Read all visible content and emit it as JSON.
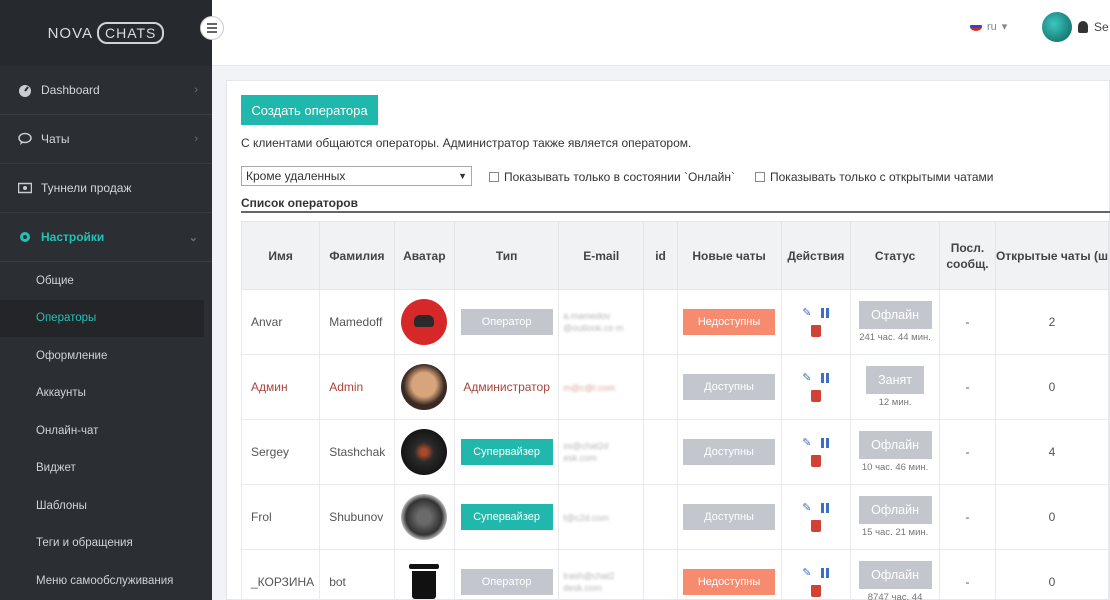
{
  "app": {
    "logo_left": "NOVA",
    "logo_right": "CHATS"
  },
  "sidebar": {
    "items": [
      {
        "label": "Dashboard",
        "icon": "dashboard-icon"
      },
      {
        "label": "Чаты",
        "icon": "chat-bubble-icon"
      },
      {
        "label": "Туннели продаж",
        "icon": "money-icon"
      },
      {
        "label": "Настройки",
        "icon": "gear-icon"
      }
    ],
    "submenu": [
      "Общие",
      "Операторы",
      "Оформление",
      "Аккаунты",
      "Онлайн-чат",
      "Виджет",
      "Шаблоны",
      "Теги и обращения",
      "Меню самообслуживания"
    ]
  },
  "topbar": {
    "lang": "ru",
    "user_name": "Se"
  },
  "main": {
    "create_button": "Создать оператора",
    "info": "С клиентами общаются операторы. Администратор также является оператором.",
    "filter_value": "Кроме удаленных",
    "checkbox_online": "Показывать только в состоянии `Онлайн`",
    "checkbox_open": "Показывать только с открытыми чатами",
    "section_title": "Список операторов"
  },
  "table": {
    "headers": [
      "Имя",
      "Фамилия",
      "Аватар",
      "Тип",
      "E-mail",
      "id",
      "Новые чаты",
      "Действия",
      "Статус",
      "Посл. сообщ.",
      "Открытые чаты (ш"
    ],
    "rows": [
      {
        "first": "Anvar",
        "last": "Mamedoff",
        "type": "Оператор",
        "email": "a.mamedov @outlook.co m",
        "new_chats": "Недоступны",
        "status": "Офлайн",
        "status_sub": "241 час. 44 мин.",
        "last_msg": "-",
        "open": "2"
      },
      {
        "first": "Админ",
        "last": "Admin",
        "type": "Администратор",
        "email": "m@c@l.com",
        "new_chats": "Доступны",
        "status": "Занят",
        "status_sub": "12 мин.",
        "last_msg": "-",
        "open": "0"
      },
      {
        "first": "Sergey",
        "last": "Stashchak",
        "type": "Супервайзер",
        "email": "ss@chat2d esk.com",
        "new_chats": "Доступны",
        "status": "Офлайн",
        "status_sub": "10 час. 46 мин.",
        "last_msg": "-",
        "open": "4"
      },
      {
        "first": "Frol",
        "last": "Shubunov",
        "type": "Супервайзер",
        "email": "f@c2d.com",
        "new_chats": "Доступны",
        "status": "Офлайн",
        "status_sub": "15 час. 21 мин.",
        "last_msg": "-",
        "open": "0"
      },
      {
        "first": "_КОРЗИНА",
        "last": "bot",
        "type": "Оператор",
        "email": "trash@chat2 desk.com",
        "new_chats": "Недоступны",
        "status": "Офлайн",
        "status_sub": "8747 час. 44",
        "last_msg": "-",
        "open": "0"
      }
    ]
  }
}
